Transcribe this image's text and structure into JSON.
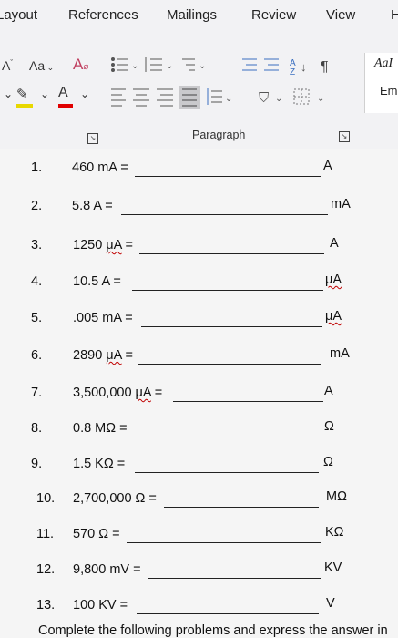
{
  "ribbon": {
    "tabs": [
      "Layout",
      "References",
      "Mailings",
      "Review",
      "View",
      "H"
    ],
    "font_size_label": "Aa",
    "styles_preview": [
      "AaI",
      "Em"
    ],
    "group_label": "Paragraph"
  },
  "problems": [
    {
      "num": "1.",
      "pre": "460 mA =",
      "unit": "",
      "answer_unit": "A"
    },
    {
      "num": "2.",
      "pre": "5.8 A =",
      "unit": "",
      "answer_unit": "mA"
    },
    {
      "num": "3.",
      "pre": "1250 ",
      "unit": "μA",
      "post": " =",
      "answer_unit": "A"
    },
    {
      "num": "4.",
      "pre": "10.5 A =",
      "unit": "",
      "answer_unit": "μA"
    },
    {
      "num": "5.",
      "pre": ".005 mA =",
      "unit": "",
      "answer_unit": "μA"
    },
    {
      "num": "6.",
      "pre": "2890 ",
      "unit": "μA",
      "post": " =",
      "answer_unit": "mA"
    },
    {
      "num": "7.",
      "pre": "3,500,000 ",
      "unit": "μA",
      "post": " =",
      "answer_unit": "A"
    },
    {
      "num": "8.",
      "pre": "0.8 MΩ =",
      "unit": "",
      "answer_unit": "Ω"
    },
    {
      "num": "9.",
      "pre": "1.5 KΩ =",
      "unit": "",
      "answer_unit": "Ω"
    },
    {
      "num": "10.",
      "pre": "2,700,000 Ω =",
      "unit": "",
      "answer_unit": "MΩ"
    },
    {
      "num": "11.",
      "pre": "570 Ω =",
      "unit": "",
      "answer_unit": "KΩ"
    },
    {
      "num": "12.",
      "pre": "9,800 mV =",
      "unit": "",
      "answer_unit": "KV"
    },
    {
      "num": "13.",
      "pre": "100 KV =",
      "unit": "",
      "answer_unit": "V"
    }
  ],
  "footer_text": "Complete the following problems and express the answer in"
}
